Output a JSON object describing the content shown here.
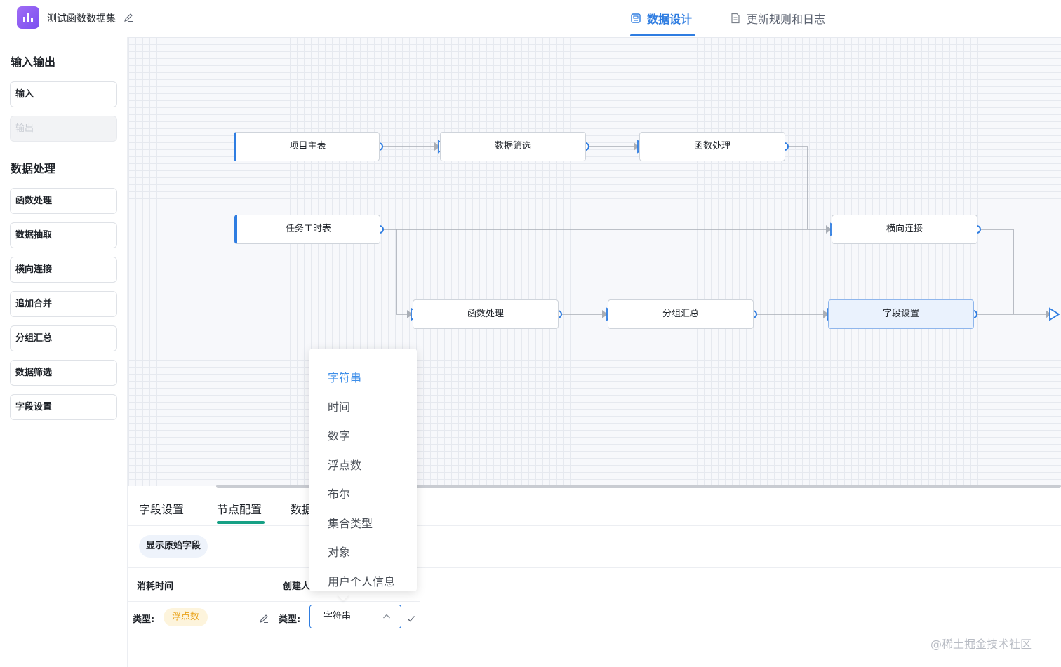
{
  "header": {
    "dataset_title": "测试函数数据集",
    "tabs": [
      {
        "label": "数据设计",
        "active": true
      },
      {
        "label": "更新规则和日志",
        "active": false
      }
    ]
  },
  "sidebar": {
    "sections": [
      {
        "heading": "输入输出",
        "items": [
          {
            "label": "输入",
            "disabled": false
          },
          {
            "label": "输出",
            "disabled": true
          }
        ]
      },
      {
        "heading": "数据处理",
        "items": [
          {
            "label": "函数处理",
            "disabled": false
          },
          {
            "label": "数据抽取",
            "disabled": false
          },
          {
            "label": "横向连接",
            "disabled": false
          },
          {
            "label": "追加合并",
            "disabled": false
          },
          {
            "label": "分组汇总",
            "disabled": false
          },
          {
            "label": "数据筛选",
            "disabled": false
          },
          {
            "label": "字段设置",
            "disabled": false
          }
        ]
      }
    ]
  },
  "canvas": {
    "nodes": [
      {
        "label": "项目主表"
      },
      {
        "label": "数据筛选"
      },
      {
        "label": "函数处理"
      },
      {
        "label": "任务工时表"
      },
      {
        "label": "横向连接"
      },
      {
        "label": "函数处理"
      },
      {
        "label": "分组汇总"
      },
      {
        "label": "字段设置"
      }
    ]
  },
  "bottom_panel": {
    "tabs": [
      {
        "label": "字段设置",
        "active": false
      },
      {
        "label": "节点配置",
        "active": true
      },
      {
        "label": "数据",
        "active": false
      }
    ],
    "show_original_button": "显示原始字段",
    "columns": [
      {
        "header": "消耗时间",
        "type_label": "类型:",
        "type_value": "浮点数"
      },
      {
        "header": "创建人",
        "type_label": "类型:",
        "type_value": "字符串"
      }
    ]
  },
  "type_dropdown": {
    "options": [
      "字符串",
      "时间",
      "数字",
      "浮点数",
      "布尔",
      "集合类型",
      "对象",
      "用户个人信息"
    ],
    "selected": "字符串"
  },
  "watermark": "@稀土掘金技术社区",
  "colors": {
    "accent": "#2f7de1",
    "tab_indicator": "#16a085",
    "float_badge_text": "#e9a31a",
    "float_badge_bg": "#fdf4dc",
    "app_icon": "#8a5cf3"
  }
}
